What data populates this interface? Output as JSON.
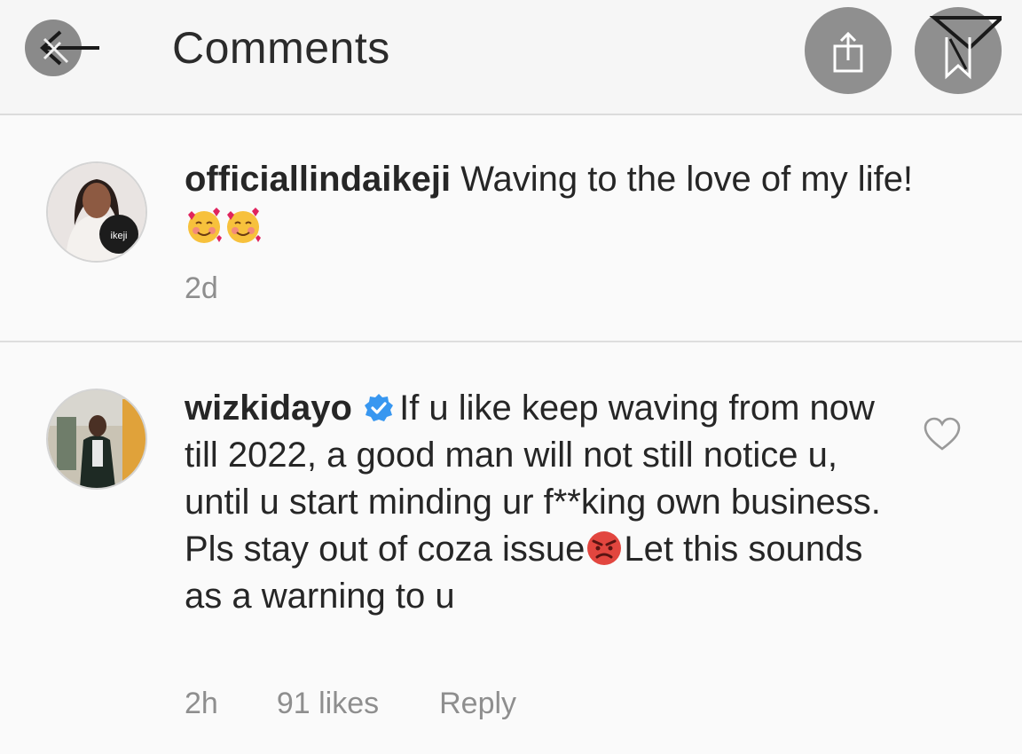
{
  "header": {
    "title": "Comments"
  },
  "comments": [
    {
      "username": "officiallindaikeji",
      "text": "Waving to the love of my life!",
      "time": "2d",
      "avatar_badge": "ikeji"
    },
    {
      "username": "wizkidayo",
      "verified": true,
      "text_part1": "If u like keep waving from now till 2022, a good man will not still notice u, until u start minding ur f**king own business. Pls stay out of coza issue",
      "text_part2": "Let this sounds as a warning to u",
      "time": "2h",
      "likes": "91 likes",
      "reply": "Reply"
    }
  ],
  "colors": {
    "icon_circle": "#8f8f8f",
    "verified_blue": "#3897f0",
    "meta_gray": "#8e8e8e",
    "text": "#262626"
  }
}
